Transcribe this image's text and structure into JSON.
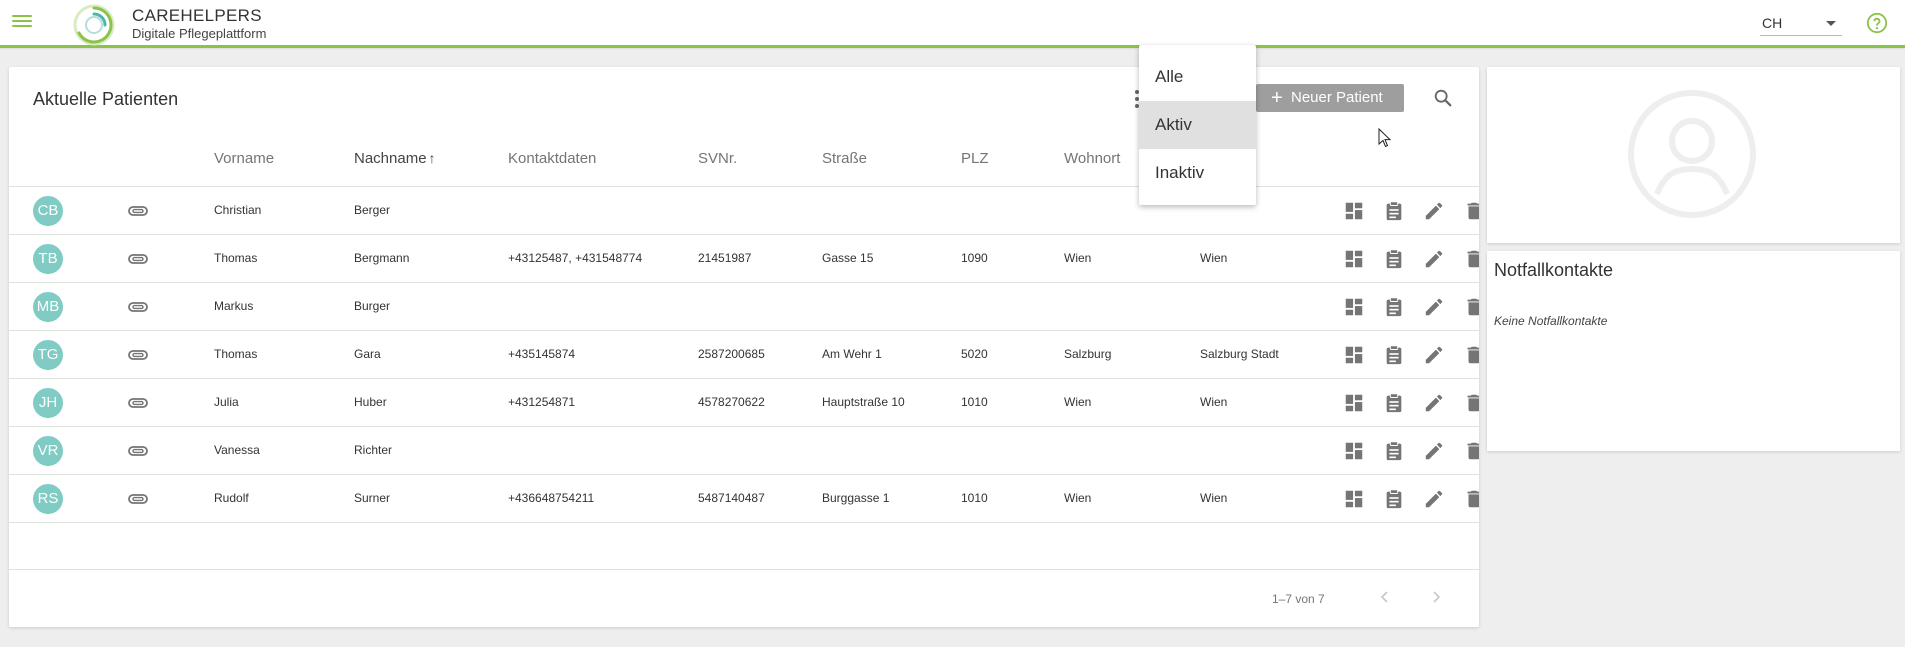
{
  "header": {
    "brand_title": "CAREHELPERS",
    "brand_subtitle": "Digitale Pflegeplattform",
    "language": "CH",
    "accent_color": "#8bc34a",
    "icons": {
      "menu": "menu-icon",
      "help": "help-circle-icon"
    }
  },
  "patients": {
    "title": "Aktuelle Patienten",
    "new_button_label": "Neuer Patient",
    "columns": [
      "Vorname",
      "Nachname",
      "Kontaktdaten",
      "SVNr.",
      "Straße",
      "PLZ",
      "Wohnort",
      ""
    ],
    "sorted_column": "Nachname",
    "rows": [
      {
        "initials": "CB",
        "vorname": "Christian",
        "nachname": "Berger",
        "kontakt": "",
        "svnr": "",
        "strasse": "",
        "plz": "",
        "wohnort": "",
        "bezirk": ""
      },
      {
        "initials": "TB",
        "vorname": "Thomas",
        "nachname": "Bergmann",
        "kontakt": "+43125487, +431548774",
        "svnr": "21451987",
        "strasse": "Gasse 15",
        "plz": "1090",
        "wohnort": "Wien",
        "bezirk": "Wien"
      },
      {
        "initials": "MB",
        "vorname": "Markus",
        "nachname": "Burger",
        "kontakt": "",
        "svnr": "",
        "strasse": "",
        "plz": "",
        "wohnort": "",
        "bezirk": ""
      },
      {
        "initials": "TG",
        "vorname": "Thomas",
        "nachname": "Gara",
        "kontakt": "+435145874",
        "svnr": "2587200685",
        "strasse": "Am Wehr 1",
        "plz": "5020",
        "wohnort": "Salzburg",
        "bezirk": "Salzburg Stadt"
      },
      {
        "initials": "JH",
        "vorname": "Julia",
        "nachname": "Huber",
        "kontakt": "+431254871",
        "svnr": "4578270622",
        "strasse": "Hauptstraße 10",
        "plz": "1010",
        "wohnort": "Wien",
        "bezirk": "Wien"
      },
      {
        "initials": "VR",
        "vorname": "Vanessa",
        "nachname": "Richter",
        "kontakt": "",
        "svnr": "",
        "strasse": "",
        "plz": "",
        "wohnort": "",
        "bezirk": ""
      },
      {
        "initials": "RS",
        "vorname": "Rudolf",
        "nachname": "Surner",
        "kontakt": "+436648754211",
        "svnr": "5487140487",
        "strasse": "Burggasse 1",
        "plz": "1010",
        "wohnort": "Wien",
        "bezirk": "Wien"
      }
    ],
    "row_actions": [
      "dashboard-icon",
      "clipboard-icon",
      "edit-icon",
      "delete-icon"
    ],
    "pagination": "1–7 von 7",
    "avatar_color": "#80cbc4"
  },
  "filter_menu": {
    "options": [
      "Alle",
      "Aktiv",
      "Inaktiv"
    ],
    "selected": "Aktiv"
  },
  "side": {
    "emergency_title": "Notfallkontakte",
    "emergency_empty": "Keine Notfallkontakte"
  }
}
